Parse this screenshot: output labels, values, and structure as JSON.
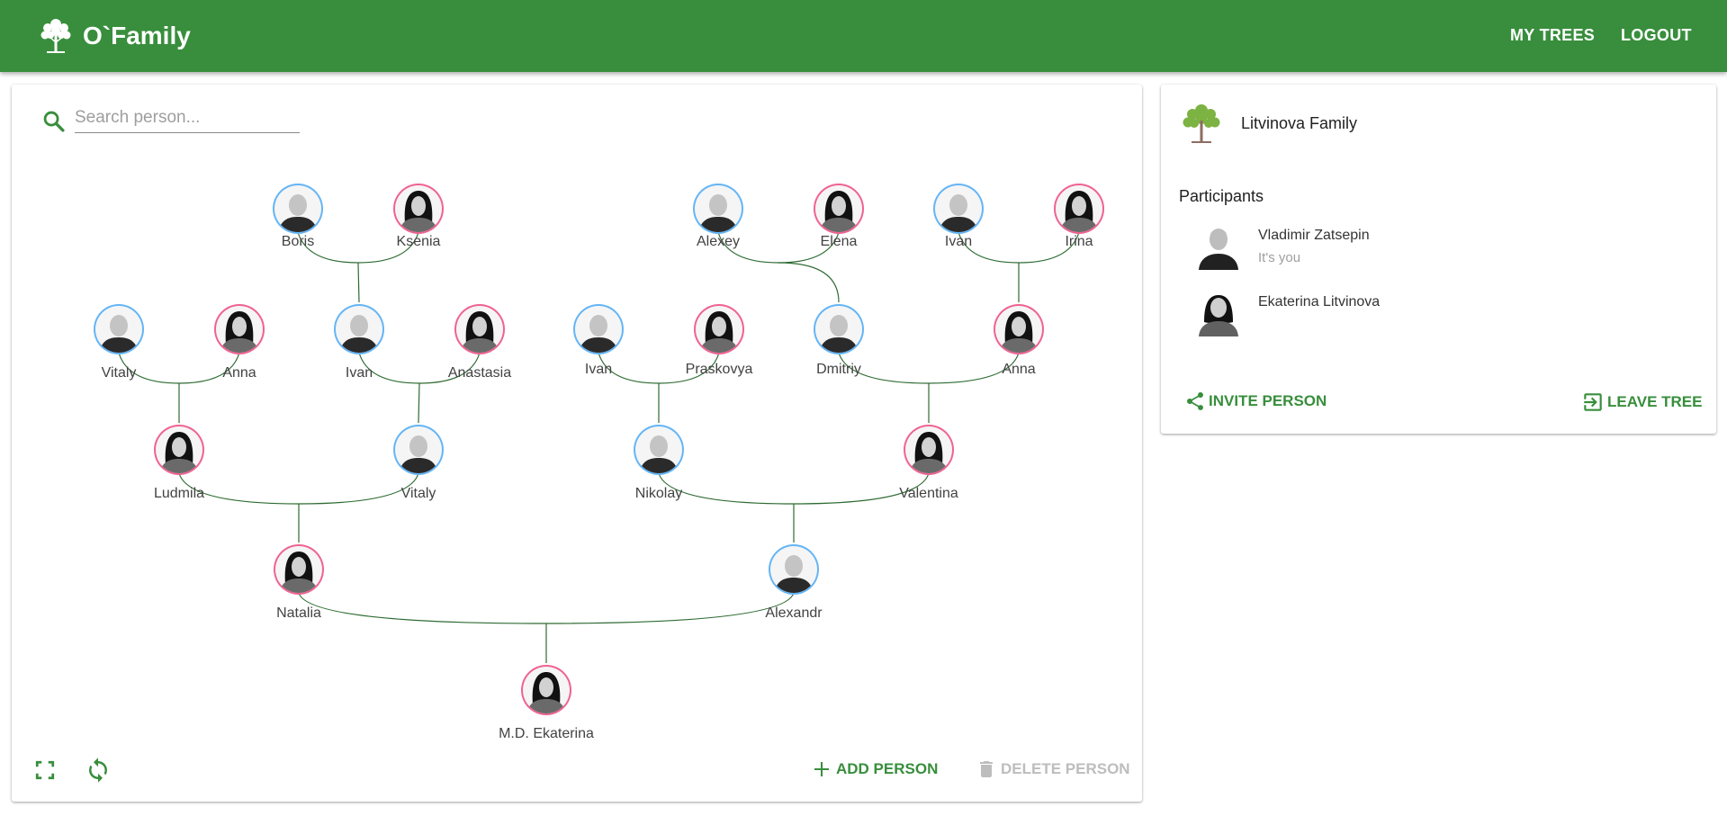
{
  "app": {
    "title": "O`Family"
  },
  "nav": {
    "my_trees": "MY TREES",
    "logout": "LOGOUT"
  },
  "search": {
    "placeholder": "Search person..."
  },
  "tree": {
    "people": [
      {
        "name": "Boris",
        "gender": "male"
      },
      {
        "name": "Ksenia",
        "gender": "female"
      },
      {
        "name": "Alexey",
        "gender": "male"
      },
      {
        "name": "Elena",
        "gender": "female"
      },
      {
        "name": "Ivan",
        "gender": "male"
      },
      {
        "name": "Irina",
        "gender": "female"
      },
      {
        "name": "Vitaly",
        "gender": "male"
      },
      {
        "name": "Anna",
        "gender": "female"
      },
      {
        "name": "Ivan",
        "gender": "male"
      },
      {
        "name": "Anastasia",
        "gender": "female"
      },
      {
        "name": "Ivan",
        "gender": "male"
      },
      {
        "name": "Praskovya",
        "gender": "female"
      },
      {
        "name": "Dmitriy",
        "gender": "male"
      },
      {
        "name": "Anna",
        "gender": "female"
      },
      {
        "name": "Ludmila",
        "gender": "female"
      },
      {
        "name": "Vitaly",
        "gender": "male"
      },
      {
        "name": "Nikolay",
        "gender": "male"
      },
      {
        "name": "Valentina",
        "gender": "female"
      },
      {
        "name": "Natalia",
        "gender": "female"
      },
      {
        "name": "Alexandr",
        "gender": "male"
      },
      {
        "name": "M.D. Ekaterina",
        "gender": "female"
      }
    ]
  },
  "actions": {
    "add_person": "ADD PERSON",
    "delete_person": "DELETE PERSON"
  },
  "family": {
    "name": "Litvinova Family",
    "participants_title": "Participants",
    "participants": [
      {
        "name": "Vladimir Zatsepin",
        "status": "It's you",
        "gender": "male"
      },
      {
        "name": "Ekaterina Litvinova",
        "status": "",
        "gender": "female"
      }
    ],
    "invite_label": "INVITE PERSON",
    "leave_label": "LEAVE TREE"
  },
  "colors": {
    "primary": "#388e3c",
    "male": "#64b5f6",
    "female": "#f06292",
    "disabled": "#bdbdbd"
  }
}
